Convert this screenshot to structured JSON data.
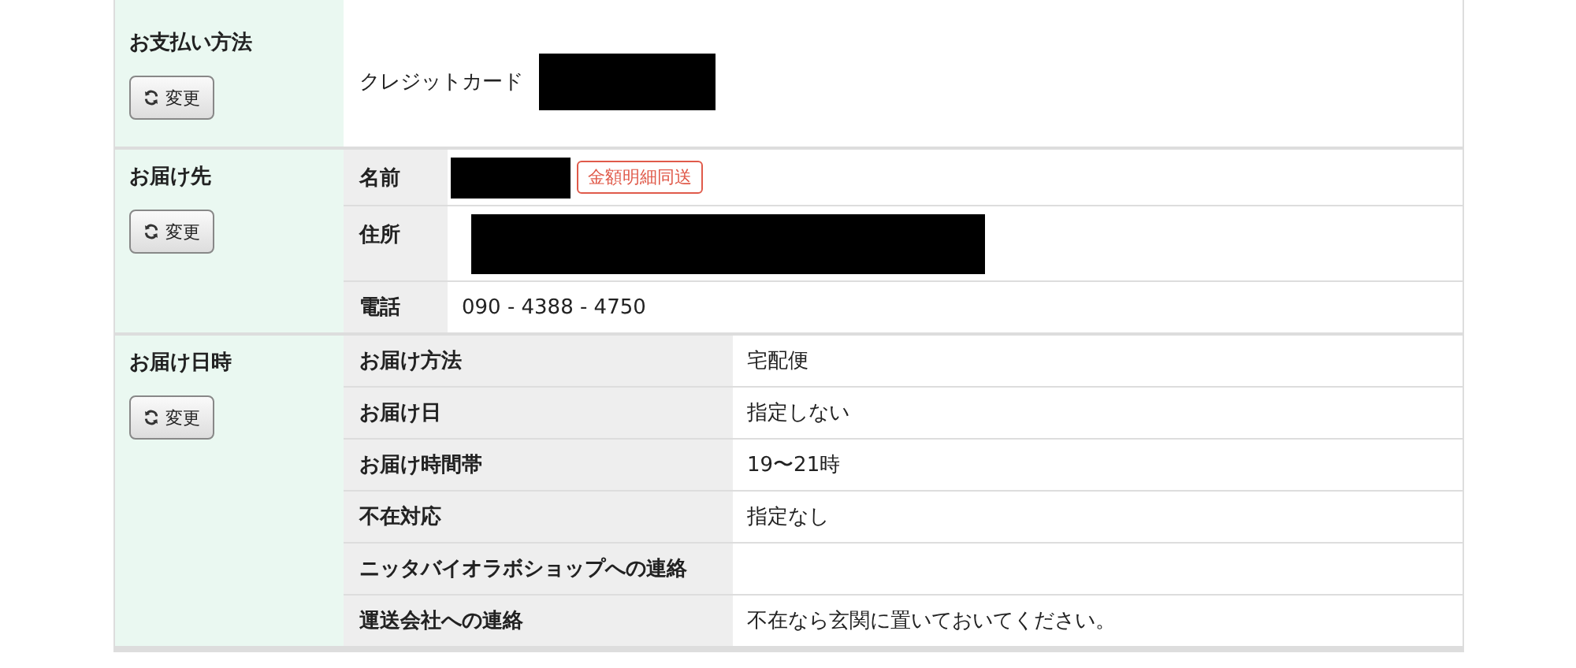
{
  "sections": [
    {
      "kind": "text",
      "heading": "お支払い方法",
      "button": "変更",
      "value": "クレジットカード",
      "redacted": true
    },
    {
      "kind": "fields",
      "heading": "お届け先",
      "button": "変更",
      "rows": [
        {
          "label": "名前",
          "redacted": true,
          "badge": "金額明細同送"
        },
        {
          "label": "住所",
          "redacted": true
        },
        {
          "label": "電話",
          "value": "090 - 4388 - 4750"
        }
      ]
    },
    {
      "kind": "wide",
      "heading": "お届け日時",
      "button": "変更",
      "rows": [
        {
          "label": "お届け方法",
          "value": "宅配便"
        },
        {
          "label": "お届け日",
          "value": "指定しない"
        },
        {
          "label": "お届け時間帯",
          "value": "19〜21時"
        },
        {
          "label": "不在対応",
          "value": "指定なし"
        },
        {
          "label": "ニッタバイオラボショップへの連絡"
        },
        {
          "label": "運送会社への連絡",
          "value": "不在なら玄関に置いておいてください。"
        }
      ]
    }
  ]
}
